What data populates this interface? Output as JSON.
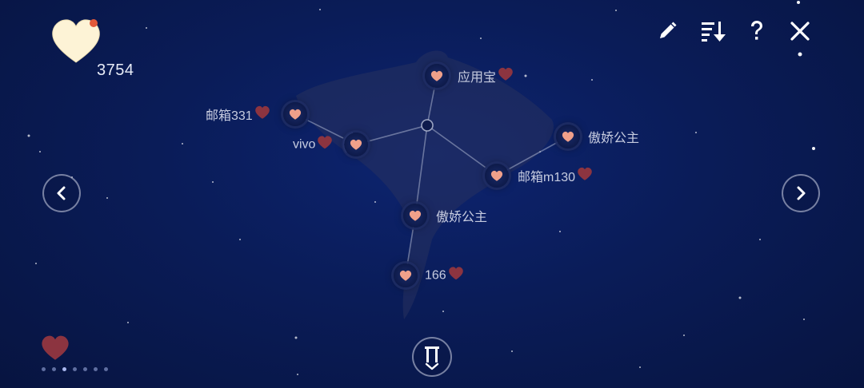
{
  "currency": {
    "amount": "3754"
  },
  "toolbar": {
    "icons": [
      "pencil-icon",
      "sort-descending-icon",
      "help-icon",
      "close-icon"
    ]
  },
  "nodes": [
    {
      "id": "yingyongbao",
      "label": "应用宝",
      "hearted": true
    },
    {
      "id": "youxiang331",
      "label": "邮箱331",
      "hearted": true
    },
    {
      "id": "vivo",
      "label": "vivo",
      "hearted": true
    },
    {
      "id": "aojiao1",
      "label": "傲娇公主",
      "hearted": false
    },
    {
      "id": "youxiang130",
      "label": "邮箱m130",
      "hearted": true
    },
    {
      "id": "aojiao2",
      "label": "傲娇公主",
      "hearted": false
    },
    {
      "id": "n166",
      "label": "166",
      "hearted": true
    }
  ],
  "pagination": {
    "count": 7,
    "active": 3
  },
  "colors": {
    "accent_heart": "#f0a08a",
    "dark_heart": "#8c3440",
    "badge_red": "#e25a3a"
  }
}
